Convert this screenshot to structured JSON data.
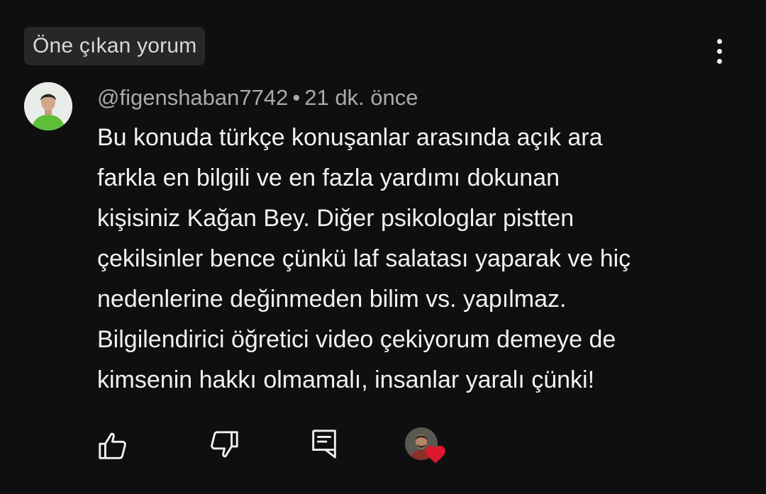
{
  "badge": {
    "label": "Öne çıkan yorum"
  },
  "comment": {
    "author": "@figenshaban7742",
    "separator": "•",
    "time": "21 dk. önce",
    "lines": [
      "Bu konuda türkçe konuşanlar arasında açık ara",
      "farkla en bilgili ve en fazla yardımı dokunan",
      "kişisiniz Kağan Bey. Diğer psikologlar pistten",
      "çekilsinler bence çünkü laf salatası yaparak ve hiç",
      "nedenlerine değinmeden bilim vs. yapılmaz.",
      "Bilgilendirici öğretici video çekiyorum demeye de",
      "kimsenin hakkı olmamalı, insanlar yaralı çünki!"
    ]
  },
  "icons": {
    "menu": "more-vert-icon",
    "like": "thumbs-up-icon",
    "dislike": "thumbs-down-icon",
    "reply": "comment-reply-icon",
    "heart": "heart-icon"
  },
  "colors": {
    "background": "#0f0f0f",
    "badge_bg": "#272727",
    "text_primary": "#f1f1f1",
    "text_secondary": "#aaaaaa",
    "heart": "#e0182d"
  }
}
